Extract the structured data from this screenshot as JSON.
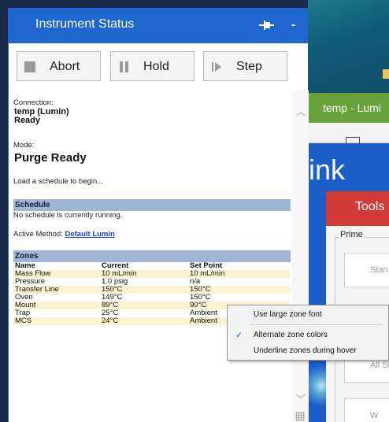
{
  "status_window": {
    "title": "Instrument Status",
    "pin_icon": "pin-icon",
    "minimize_label": "-",
    "toolbar": {
      "abort_label": "Abort",
      "hold_label": "Hold",
      "step_label": "Step"
    },
    "connection": {
      "label": "Connection:",
      "name": "temp (Lumin)",
      "state": "Ready"
    },
    "mode": {
      "label": "Mode:",
      "value": "Purge Ready"
    },
    "load_message": "Load a schedule to begin...",
    "schedule": {
      "header": "Schedule",
      "message": "No schedule is currently running.",
      "active_method_label": "Active Method:",
      "active_method_link": "Default Lumin"
    },
    "zones": {
      "header": "Zones",
      "columns": [
        "Name",
        "Current",
        "Set Point"
      ],
      "rows": [
        {
          "name": "Mass Flow",
          "current": "10 mL/min",
          "set_point": "10 mL/min"
        },
        {
          "name": "Pressure",
          "current": "1.0 psig",
          "set_point": "n/a"
        },
        {
          "name": "Transfer Line",
          "current": "150°C",
          "set_point": "150°C"
        },
        {
          "name": "Oven",
          "current": "149°C",
          "set_point": "150°C"
        },
        {
          "name": "Mount",
          "current": "89°C",
          "set_point": "90°C"
        },
        {
          "name": "Trap",
          "current": "25°C",
          "set_point": "Ambient"
        },
        {
          "name": "MCS",
          "current": "24°C",
          "set_point": "Ambient"
        }
      ]
    }
  },
  "context_menu": {
    "items": [
      {
        "label": "Use large zone font",
        "checked": false
      },
      {
        "label": "Alternate zone colors",
        "checked": true
      },
      {
        "label": "Underline zones during hover",
        "checked": false
      }
    ]
  },
  "background_app": {
    "tab_label": "temp - Lumi",
    "big_text": "ink",
    "tools_title": "Tools",
    "prime_label": "Prime",
    "buttons": [
      "Stan",
      "All Sta",
      "W"
    ]
  },
  "colors": {
    "titlebar": "#1f66cf",
    "section_header": "#9fb5d2",
    "alt_row": "#fbf2cf",
    "tab_green": "#6aa23a",
    "tools_red": "#d23a37",
    "link": "#1a3fc4"
  }
}
